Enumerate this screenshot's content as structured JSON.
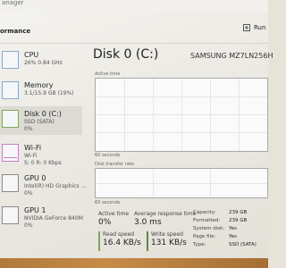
{
  "window": {
    "title_fragment": "anager"
  },
  "header": {
    "section_label": "ormance",
    "run_label": "Run"
  },
  "sidebar": {
    "items": [
      {
        "name": "CPU",
        "sub1": "26% 0.84 GHz",
        "sub2": ""
      },
      {
        "name": "Memory",
        "sub1": "3.1/15.9 GB (19%)",
        "sub2": ""
      },
      {
        "name": "Disk 0 (C:)",
        "sub1": "SSD (SATA)",
        "sub2": "0%"
      },
      {
        "name": "Wi-Fi",
        "sub1": "Wi-Fi",
        "sub2": "S: 0 R: 0 Kbps"
      },
      {
        "name": "GPU 0",
        "sub1": "Intel(R) HD Graphics ...",
        "sub2": "0%"
      },
      {
        "name": "GPU 1",
        "sub1": "NVIDIA GeForce 840M",
        "sub2": "0%"
      }
    ]
  },
  "main": {
    "title": "Disk 0 (C:)",
    "model": "SAMSUNG MZ7LN256H",
    "graph1_label": "Active time",
    "graph1_time": "60 seconds",
    "graph2_label": "Disk transfer rate",
    "graph2_time": "60 seconds",
    "stats": {
      "active_time_label": "Active time",
      "active_time_value": "0%",
      "response_label": "Average response time",
      "response_value": "3.0 ms",
      "read_label": "Read speed",
      "read_value": "16.4 KB/s",
      "write_label": "Write speed",
      "write_value": "131 KB/s"
    },
    "specs": [
      {
        "label": "Capacity:",
        "value": "239 GB"
      },
      {
        "label": "Formatted:",
        "value": "239 GB"
      },
      {
        "label": "System disk:",
        "value": "Yes"
      },
      {
        "label": "Page file:",
        "value": "Yes"
      },
      {
        "label": "Type:",
        "value": "SSD (SATA)"
      }
    ]
  },
  "colors": {
    "read_accent": "#7fa65a",
    "write_accent": "#5e8a3c"
  }
}
